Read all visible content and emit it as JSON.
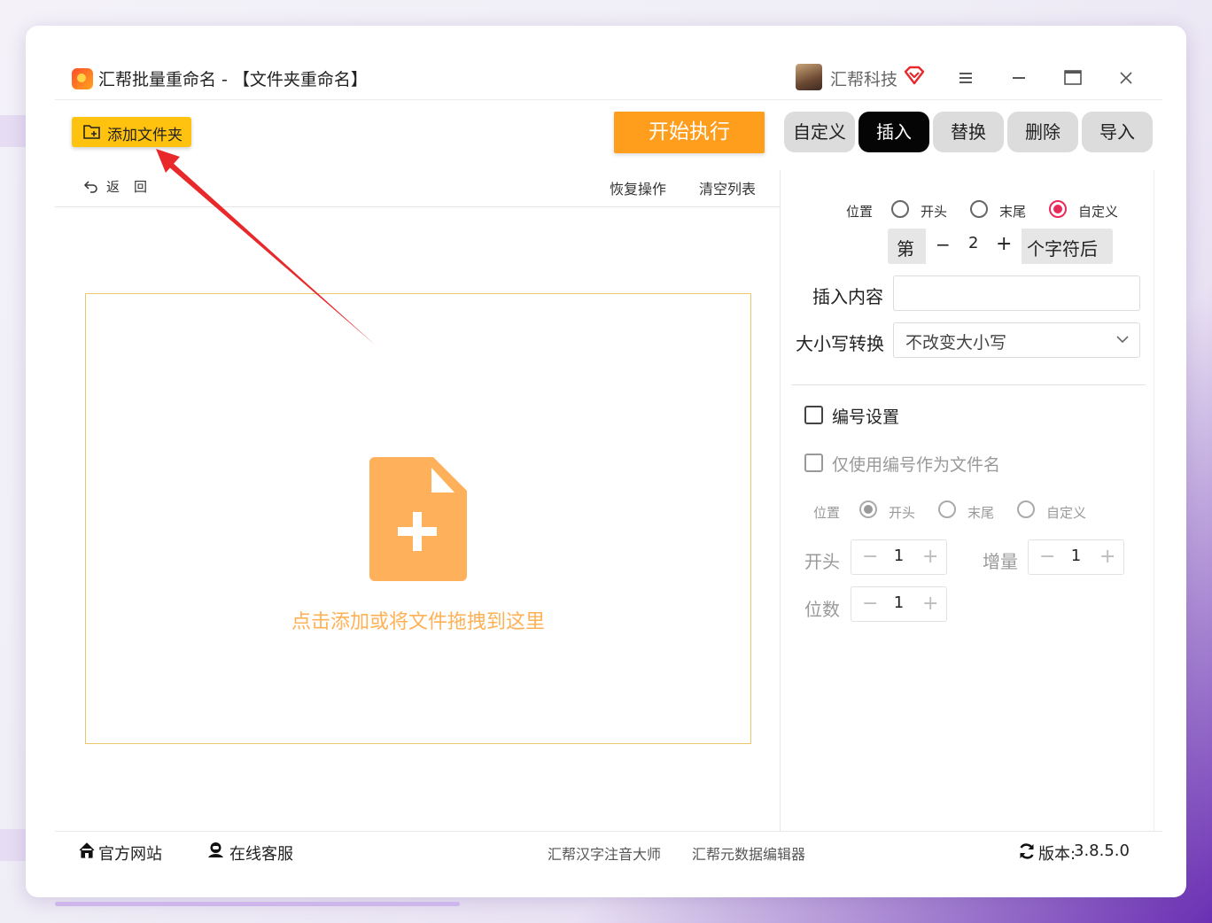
{
  "titlebar": {
    "title": "汇帮批量重命名 - 【文件夹重命名】",
    "brand": "汇帮科技"
  },
  "toolbar": {
    "add_folder_label": "添加文件夹",
    "start_label": "开始执行",
    "back_label": "返回",
    "restore_label": "恢复操作",
    "clear_label": "清空列表"
  },
  "tabs": [
    {
      "label": "自定义",
      "active": false
    },
    {
      "label": "插入",
      "active": true
    },
    {
      "label": "替换",
      "active": false
    },
    {
      "label": "删除",
      "active": false
    },
    {
      "label": "导入",
      "active": false
    }
  ],
  "dropzone": {
    "text": "点击添加或将文件拖拽到这里"
  },
  "insert_panel": {
    "position_label": "位置",
    "position_options": [
      "开头",
      "末尾",
      "自定义"
    ],
    "position_selected": "自定义",
    "stepper_prefix": "第",
    "stepper_minus": "−",
    "stepper_value": "2",
    "stepper_plus": "+",
    "stepper_suffix": "个字符后",
    "content_label": "插入内容",
    "content_value": "",
    "case_label": "大小写转换",
    "case_value": "不改变大小写"
  },
  "numbering": {
    "enable_label": "编号设置",
    "enable_checked": false,
    "only_number_label": "仅使用编号作为文件名",
    "only_number_checked": false,
    "position_label": "位置",
    "position_options": [
      "开头",
      "末尾",
      "自定义"
    ],
    "position_selected": "开头",
    "start_label": "开头",
    "start_value": "1",
    "increment_label": "增量",
    "increment_value": "1",
    "digits_label": "位数",
    "digits_value": "1",
    "minus": "−",
    "plus": "+"
  },
  "footer": {
    "website": "官方网站",
    "support": "在线客服",
    "link1": "汇帮汉字注音大师",
    "link2": "汇帮元数据编辑器",
    "version_label": "版本:",
    "version_value": "3.8.5.0"
  },
  "colors": {
    "add_button": "#ffc20e",
    "start_button": "#ff9d1c",
    "active_tab": "#050505",
    "radio_selected": "#e82a5a",
    "dropzone_text": "#ffb156",
    "annotation_arrow": "#e8282a"
  }
}
